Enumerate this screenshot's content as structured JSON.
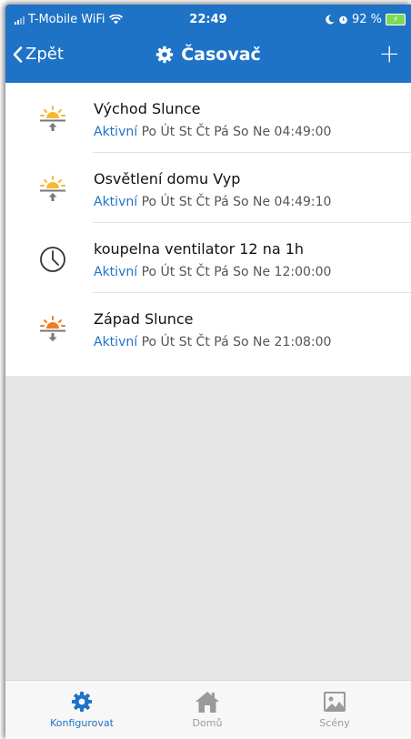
{
  "status_bar": {
    "carrier": "T-Mobile WiFi",
    "time": "22:49",
    "battery": "92 %"
  },
  "nav": {
    "back_label": "Zpět",
    "title": "Časovač",
    "add_label": "+"
  },
  "timers": [
    {
      "name": "Východ Slunce",
      "status": "Aktivní",
      "schedule": "Po Út St Čt Pá So Ne 04:49:00",
      "icon": "sunrise-icon"
    },
    {
      "name": "Osvětlení domu Vyp",
      "status": "Aktivní",
      "schedule": "Po Út St Čt Pá So Ne 04:49:10",
      "icon": "sunrise-icon"
    },
    {
      "name": "koupelna ventilator 12 na 1h",
      "status": "Aktivní",
      "schedule": "Po Út St Čt Pá So Ne 12:00:00",
      "icon": "clock-icon"
    },
    {
      "name": "Západ Slunce",
      "status": "Aktivní",
      "schedule": "Po Út St Čt Pá So Ne 21:08:00",
      "icon": "sunset-icon"
    }
  ],
  "tabs": [
    {
      "label": "Konfigurovat",
      "icon": "gear-icon",
      "active": true
    },
    {
      "label": "Domů",
      "icon": "home-icon",
      "active": false
    },
    {
      "label": "Scény",
      "icon": "scenes-icon",
      "active": false
    }
  ],
  "colors": {
    "primary": "#1e73c6",
    "sun_yellow": "#f5b82e",
    "sun_orange": "#f07b22",
    "inactive_tab": "#9a9a9a",
    "content_bg": "#e6e6e6"
  }
}
